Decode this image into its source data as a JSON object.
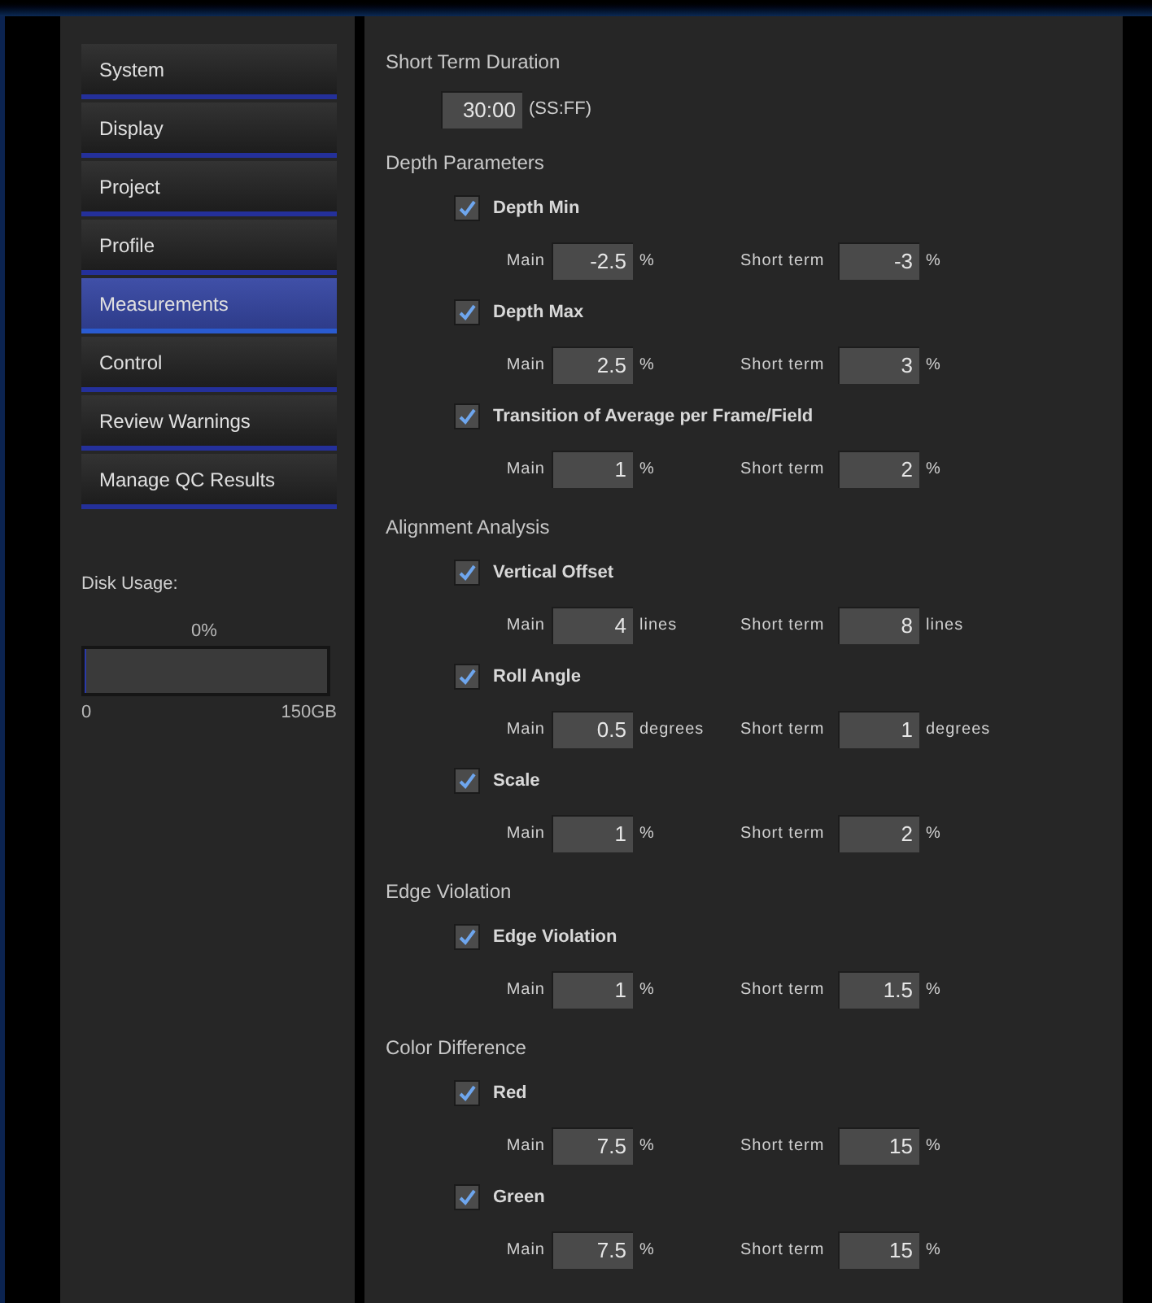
{
  "sidebar": {
    "items": [
      {
        "label": "System",
        "selected": false
      },
      {
        "label": "Display",
        "selected": false
      },
      {
        "label": "Project",
        "selected": false
      },
      {
        "label": "Profile",
        "selected": false
      },
      {
        "label": "Measurements",
        "selected": true
      },
      {
        "label": "Control",
        "selected": false
      },
      {
        "label": "Review Warnings",
        "selected": false
      },
      {
        "label": "Manage QC Results",
        "selected": false
      }
    ],
    "disk_usage": {
      "label": "Disk Usage:",
      "percent": "0%",
      "level": 0.01,
      "min": "0",
      "max": "150GB"
    }
  },
  "duration": {
    "title": "Short Term Duration",
    "value": "30:00",
    "unit": "(SS:FF)"
  },
  "sections": [
    {
      "title": "Depth Parameters",
      "items": [
        {
          "label": "Depth Min",
          "checked": true,
          "main_label": "Main",
          "main_value": "-2.5",
          "main_unit": "%",
          "short_label": "Short term",
          "short_value": "-3",
          "short_unit": "%"
        },
        {
          "label": "Depth Max",
          "checked": true,
          "main_label": "Main",
          "main_value": "2.5",
          "main_unit": "%",
          "short_label": "Short term",
          "short_value": "3",
          "short_unit": "%"
        },
        {
          "label": "Transition of Average per Frame/Field",
          "checked": true,
          "main_label": "Main",
          "main_value": "1",
          "main_unit": "%",
          "short_label": "Short term",
          "short_value": "2",
          "short_unit": "%"
        }
      ]
    },
    {
      "title": "Alignment Analysis",
      "items": [
        {
          "label": "Vertical Offset",
          "checked": true,
          "main_label": "Main",
          "main_value": "4",
          "main_unit": "lines",
          "short_label": "Short term",
          "short_value": "8",
          "short_unit": "lines"
        },
        {
          "label": "Roll Angle",
          "checked": true,
          "main_label": "Main",
          "main_value": "0.5",
          "main_unit": "degrees",
          "short_label": "Short term",
          "short_value": "1",
          "short_unit": "degrees"
        },
        {
          "label": "Scale",
          "checked": true,
          "main_label": "Main",
          "main_value": "1",
          "main_unit": "%",
          "short_label": "Short term",
          "short_value": "2",
          "short_unit": "%"
        }
      ]
    },
    {
      "title": "Edge Violation",
      "items": [
        {
          "label": "Edge Violation",
          "checked": true,
          "main_label": "Main",
          "main_value": "1",
          "main_unit": "%",
          "short_label": "Short term",
          "short_value": "1.5",
          "short_unit": "%"
        }
      ]
    },
    {
      "title": "Color Difference",
      "items": [
        {
          "label": "Red",
          "checked": true,
          "main_label": "Main",
          "main_value": "7.5",
          "main_unit": "%",
          "short_label": "Short term",
          "short_value": "15",
          "short_unit": "%"
        },
        {
          "label": "Green",
          "checked": true,
          "main_label": "Main",
          "main_value": "7.5",
          "main_unit": "%",
          "short_label": "Short term",
          "short_value": "15",
          "short_unit": "%"
        }
      ]
    }
  ]
}
